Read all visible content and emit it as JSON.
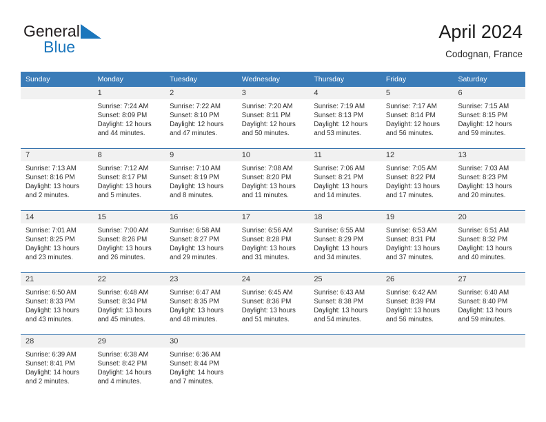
{
  "brand": {
    "name_part1": "General",
    "name_part2": "Blue",
    "logo_icon": "triangle-logo-icon",
    "color_primary": "#1b76bc",
    "color_text": "#231f20"
  },
  "header": {
    "title": "April 2024",
    "subtitle": "Codognan, France"
  },
  "theme": {
    "header_row_bg": "#3b7cb8",
    "row_divider": "#2d6ca8",
    "day_band_bg": "#f1f1f1",
    "page_bg": "#ffffff"
  },
  "weekdays": [
    "Sunday",
    "Monday",
    "Tuesday",
    "Wednesday",
    "Thursday",
    "Friday",
    "Saturday"
  ],
  "weeks": [
    [
      {
        "day": "",
        "lines": []
      },
      {
        "day": "1",
        "lines": [
          "Sunrise: 7:24 AM",
          "Sunset: 8:09 PM",
          "Daylight: 12 hours",
          "and 44 minutes."
        ]
      },
      {
        "day": "2",
        "lines": [
          "Sunrise: 7:22 AM",
          "Sunset: 8:10 PM",
          "Daylight: 12 hours",
          "and 47 minutes."
        ]
      },
      {
        "day": "3",
        "lines": [
          "Sunrise: 7:20 AM",
          "Sunset: 8:11 PM",
          "Daylight: 12 hours",
          "and 50 minutes."
        ]
      },
      {
        "day": "4",
        "lines": [
          "Sunrise: 7:19 AM",
          "Sunset: 8:13 PM",
          "Daylight: 12 hours",
          "and 53 minutes."
        ]
      },
      {
        "day": "5",
        "lines": [
          "Sunrise: 7:17 AM",
          "Sunset: 8:14 PM",
          "Daylight: 12 hours",
          "and 56 minutes."
        ]
      },
      {
        "day": "6",
        "lines": [
          "Sunrise: 7:15 AM",
          "Sunset: 8:15 PM",
          "Daylight: 12 hours",
          "and 59 minutes."
        ]
      }
    ],
    [
      {
        "day": "7",
        "lines": [
          "Sunrise: 7:13 AM",
          "Sunset: 8:16 PM",
          "Daylight: 13 hours",
          "and 2 minutes."
        ]
      },
      {
        "day": "8",
        "lines": [
          "Sunrise: 7:12 AM",
          "Sunset: 8:17 PM",
          "Daylight: 13 hours",
          "and 5 minutes."
        ]
      },
      {
        "day": "9",
        "lines": [
          "Sunrise: 7:10 AM",
          "Sunset: 8:19 PM",
          "Daylight: 13 hours",
          "and 8 minutes."
        ]
      },
      {
        "day": "10",
        "lines": [
          "Sunrise: 7:08 AM",
          "Sunset: 8:20 PM",
          "Daylight: 13 hours",
          "and 11 minutes."
        ]
      },
      {
        "day": "11",
        "lines": [
          "Sunrise: 7:06 AM",
          "Sunset: 8:21 PM",
          "Daylight: 13 hours",
          "and 14 minutes."
        ]
      },
      {
        "day": "12",
        "lines": [
          "Sunrise: 7:05 AM",
          "Sunset: 8:22 PM",
          "Daylight: 13 hours",
          "and 17 minutes."
        ]
      },
      {
        "day": "13",
        "lines": [
          "Sunrise: 7:03 AM",
          "Sunset: 8:23 PM",
          "Daylight: 13 hours",
          "and 20 minutes."
        ]
      }
    ],
    [
      {
        "day": "14",
        "lines": [
          "Sunrise: 7:01 AM",
          "Sunset: 8:25 PM",
          "Daylight: 13 hours",
          "and 23 minutes."
        ]
      },
      {
        "day": "15",
        "lines": [
          "Sunrise: 7:00 AM",
          "Sunset: 8:26 PM",
          "Daylight: 13 hours",
          "and 26 minutes."
        ]
      },
      {
        "day": "16",
        "lines": [
          "Sunrise: 6:58 AM",
          "Sunset: 8:27 PM",
          "Daylight: 13 hours",
          "and 29 minutes."
        ]
      },
      {
        "day": "17",
        "lines": [
          "Sunrise: 6:56 AM",
          "Sunset: 8:28 PM",
          "Daylight: 13 hours",
          "and 31 minutes."
        ]
      },
      {
        "day": "18",
        "lines": [
          "Sunrise: 6:55 AM",
          "Sunset: 8:29 PM",
          "Daylight: 13 hours",
          "and 34 minutes."
        ]
      },
      {
        "day": "19",
        "lines": [
          "Sunrise: 6:53 AM",
          "Sunset: 8:31 PM",
          "Daylight: 13 hours",
          "and 37 minutes."
        ]
      },
      {
        "day": "20",
        "lines": [
          "Sunrise: 6:51 AM",
          "Sunset: 8:32 PM",
          "Daylight: 13 hours",
          "and 40 minutes."
        ]
      }
    ],
    [
      {
        "day": "21",
        "lines": [
          "Sunrise: 6:50 AM",
          "Sunset: 8:33 PM",
          "Daylight: 13 hours",
          "and 43 minutes."
        ]
      },
      {
        "day": "22",
        "lines": [
          "Sunrise: 6:48 AM",
          "Sunset: 8:34 PM",
          "Daylight: 13 hours",
          "and 45 minutes."
        ]
      },
      {
        "day": "23",
        "lines": [
          "Sunrise: 6:47 AM",
          "Sunset: 8:35 PM",
          "Daylight: 13 hours",
          "and 48 minutes."
        ]
      },
      {
        "day": "24",
        "lines": [
          "Sunrise: 6:45 AM",
          "Sunset: 8:36 PM",
          "Daylight: 13 hours",
          "and 51 minutes."
        ]
      },
      {
        "day": "25",
        "lines": [
          "Sunrise: 6:43 AM",
          "Sunset: 8:38 PM",
          "Daylight: 13 hours",
          "and 54 minutes."
        ]
      },
      {
        "day": "26",
        "lines": [
          "Sunrise: 6:42 AM",
          "Sunset: 8:39 PM",
          "Daylight: 13 hours",
          "and 56 minutes."
        ]
      },
      {
        "day": "27",
        "lines": [
          "Sunrise: 6:40 AM",
          "Sunset: 8:40 PM",
          "Daylight: 13 hours",
          "and 59 minutes."
        ]
      }
    ],
    [
      {
        "day": "28",
        "lines": [
          "Sunrise: 6:39 AM",
          "Sunset: 8:41 PM",
          "Daylight: 14 hours",
          "and 2 minutes."
        ]
      },
      {
        "day": "29",
        "lines": [
          "Sunrise: 6:38 AM",
          "Sunset: 8:42 PM",
          "Daylight: 14 hours",
          "and 4 minutes."
        ]
      },
      {
        "day": "30",
        "lines": [
          "Sunrise: 6:36 AM",
          "Sunset: 8:44 PM",
          "Daylight: 14 hours",
          "and 7 minutes."
        ]
      },
      {
        "day": "",
        "lines": []
      },
      {
        "day": "",
        "lines": []
      },
      {
        "day": "",
        "lines": []
      },
      {
        "day": "",
        "lines": []
      }
    ]
  ]
}
